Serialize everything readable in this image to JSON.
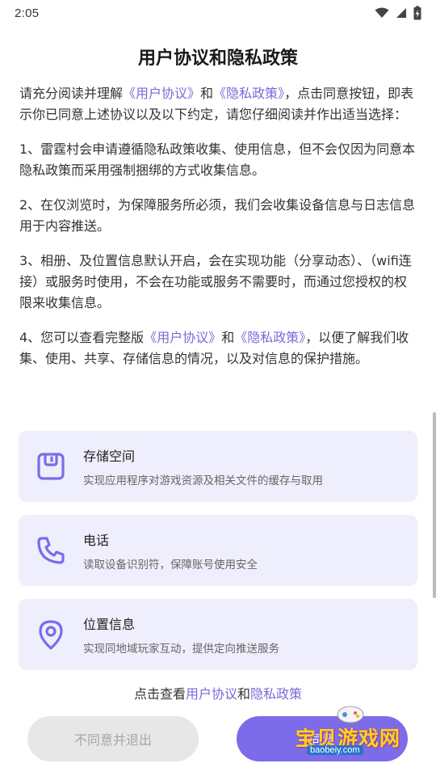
{
  "status_bar": {
    "time": "2:05"
  },
  "title": "用户协议和隐私政策",
  "intro": {
    "part1": "请充分阅读并理解",
    "link1": "《用户协议》",
    "and": "和",
    "link2": "《隐私政策》",
    "part2": "，点击同意按钮，即表示你已同意上述协议以及以下约定，请您仔细阅读并作出适当选择："
  },
  "items": [
    "1、雷霆村会申请遵循隐私政策收集、使用信息，但不会仅因为同意本隐私政策而采用强制捆绑的方式收集信息。",
    "2、在仅浏览时，为保障服务所必须，我们会收集设备信息与日志信息用于内容推送。",
    "3、相册、及位置信息默认开启，会在实现功能（分享动态）、（wifi连接）或服务时使用，不会在功能或服务不需要时，而通过您授权的权限来收集信息。"
  ],
  "item4": {
    "part1": "4、您可以查看完整版",
    "link1": "《用户协议》",
    "and": "和",
    "link2": "《隐私政策》",
    "part2": "，以便了解我们收集、使用、共享、存储信息的情况，以及对信息的保护措施。"
  },
  "permissions": [
    {
      "name": "存储空间",
      "desc": "实现应用程序对游戏资源及相关文件的缓存与取用",
      "icon": "storage-icon"
    },
    {
      "name": "电话",
      "desc": "读取设备识别符，保障账号使用安全",
      "icon": "phone-icon"
    },
    {
      "name": "位置信息",
      "desc": "实现同地域玩家互动，提供定向推送服务",
      "icon": "location-icon"
    }
  ],
  "footer_links": {
    "prefix": "点击查看",
    "user_agreement": "用户协议",
    "and": "和",
    "privacy_policy": "隐私政策"
  },
  "buttons": {
    "decline": "不同意并退出",
    "agree": "同意"
  },
  "watermark": {
    "text": "宝贝游戏网",
    "url": "baobeiy.com"
  },
  "colors": {
    "accent": "#7c6cea",
    "link": "#7a6ad9",
    "card_bg": "#efeefc",
    "decline_bg": "#e7e7e7"
  }
}
